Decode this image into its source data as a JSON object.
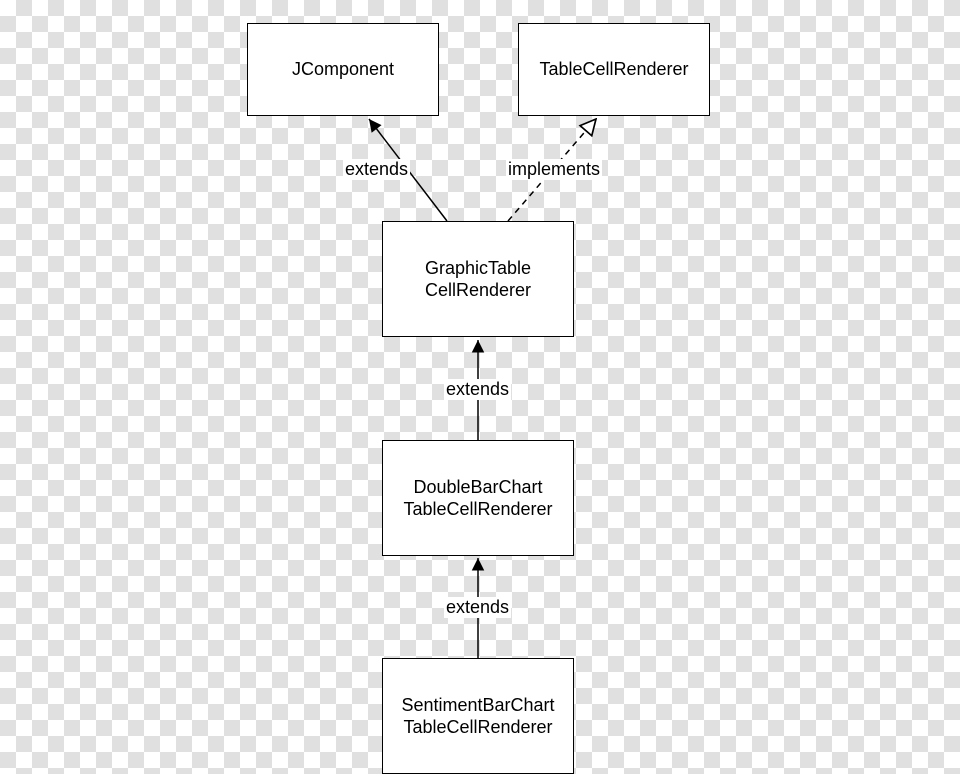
{
  "diagram": {
    "nodes": {
      "jcomponent": {
        "line1": "JComponent"
      },
      "tablecellrenderer": {
        "line1": "TableCellRenderer"
      },
      "graphictable": {
        "line1": "GraphicTable",
        "line2": "CellRenderer"
      },
      "doublebarchart": {
        "line1": "DoubleBarChart",
        "line2": "TableCellRenderer"
      },
      "sentimentbarchart": {
        "line1": "SentimentBarChart",
        "line2": "TableCellRenderer"
      }
    },
    "edges": {
      "extends1": "extends",
      "implements": "implements",
      "extends2": "extends",
      "extends3": "extends"
    }
  }
}
